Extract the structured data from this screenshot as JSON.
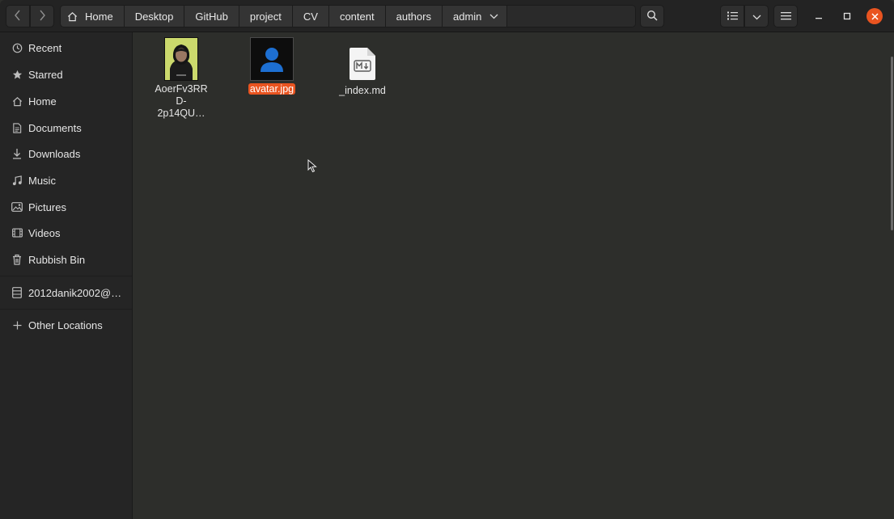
{
  "nav": {
    "back_icon": "chevron-left-icon",
    "forward_icon": "chevron-right-icon"
  },
  "pathbar": {
    "home_icon": "home-icon",
    "crumbs": [
      "Home",
      "Desktop",
      "GitHub",
      "project",
      "CV",
      "content",
      "authors",
      "admin"
    ],
    "dropdown_icon": "chevron-down-icon"
  },
  "toolbar": {
    "search_icon": "search-icon",
    "list_view_icon": "list-view-icon",
    "view_options_icon": "chevron-down-icon",
    "menu_icon": "hamburger-menu-icon"
  },
  "window_controls": {
    "minimize_icon": "minimize-icon",
    "maximize_icon": "maximize-icon",
    "close_icon": "close-icon",
    "close_color": "#e95420"
  },
  "sidebar": {
    "items": [
      {
        "label": "Recent",
        "icon": "clock-icon"
      },
      {
        "label": "Starred",
        "icon": "star-icon"
      },
      {
        "label": "Home",
        "icon": "home-icon"
      },
      {
        "label": "Documents",
        "icon": "document-icon"
      },
      {
        "label": "Downloads",
        "icon": "download-icon"
      },
      {
        "label": "Music",
        "icon": "music-icon"
      },
      {
        "label": "Pictures",
        "icon": "picture-icon"
      },
      {
        "label": "Videos",
        "icon": "video-icon"
      },
      {
        "label": "Rubbish Bin",
        "icon": "trash-icon"
      },
      {
        "label": "2012danik2002@…",
        "icon": "network-drive-icon"
      },
      {
        "label": "Other Locations",
        "icon": "plus-icon"
      }
    ]
  },
  "files": [
    {
      "name_lines": [
        "AoerFv3RR",
        "D-",
        "2p14QU…"
      ],
      "type": "image-thumbnail",
      "selected": false
    },
    {
      "name": "avatar.jpg",
      "type": "avatar-thumbnail",
      "selected": true
    },
    {
      "name": "_index.md",
      "type": "markdown-file-icon",
      "selected": false
    }
  ],
  "colors": {
    "accent": "#e95420",
    "background": "#2d2e2b",
    "sidebar": "#252525",
    "header": "#232323"
  }
}
